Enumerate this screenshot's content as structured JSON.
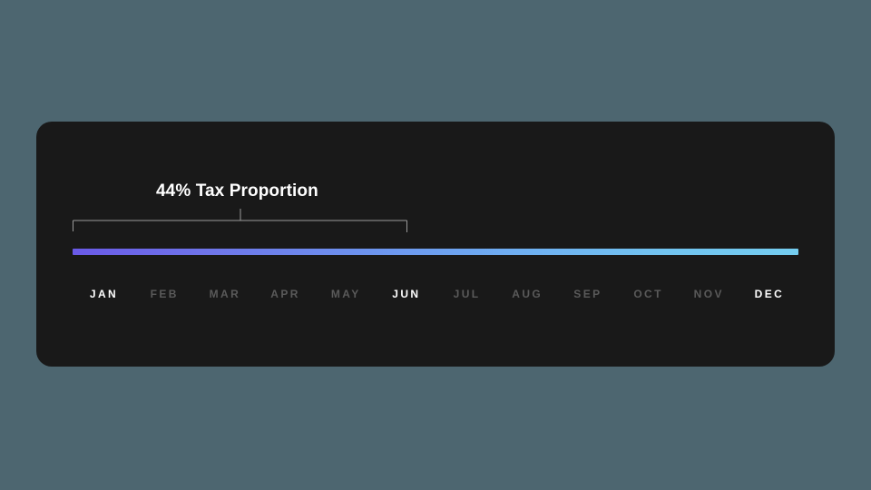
{
  "page": {
    "background_color": "#4d6670"
  },
  "card": {
    "background_color": "#191919",
    "corner_radius": "17px"
  },
  "callout": {
    "label": "44% Tax Proportion",
    "value_percent": 44,
    "metric_name": "Tax Proportion",
    "line_color": "#9a9a9a",
    "text_color": "#ffffff",
    "range_start_month": "JAN",
    "range_end_month": "JUN"
  },
  "bar": {
    "gradient_start_color": "#6a5ae8",
    "gradient_end_color": "#74cdf0",
    "fill_percent": 100
  },
  "axis": {
    "active_color": "#ffffff",
    "inactive_color": "#5a5a5a",
    "months": [
      {
        "label": "JAN",
        "active": true
      },
      {
        "label": "FEB",
        "active": false
      },
      {
        "label": "MAR",
        "active": false
      },
      {
        "label": "APR",
        "active": false
      },
      {
        "label": "MAY",
        "active": false
      },
      {
        "label": "JUN",
        "active": true
      },
      {
        "label": "JUL",
        "active": false
      },
      {
        "label": "AUG",
        "active": false
      },
      {
        "label": "SEP",
        "active": false
      },
      {
        "label": "OCT",
        "active": false
      },
      {
        "label": "NOV",
        "active": false
      },
      {
        "label": "DEC",
        "active": true
      }
    ]
  },
  "chart_data": {
    "type": "bar",
    "title": "44% Tax Proportion",
    "xlabel": "",
    "ylabel": "",
    "categories": [
      "JAN",
      "FEB",
      "MAR",
      "APR",
      "MAY",
      "JUN",
      "JUL",
      "AUG",
      "SEP",
      "OCT",
      "NOV",
      "DEC"
    ],
    "highlighted_categories": [
      "JAN",
      "JUN",
      "DEC"
    ],
    "annotations": [
      {
        "text": "44% Tax Proportion",
        "value": 44,
        "units": "%",
        "span_from": "JAN",
        "span_to": "JUN",
        "style": "bracket"
      }
    ],
    "series": [
      {
        "name": "Tax Proportion",
        "type": "gradient-bar",
        "values": [
          100
        ],
        "gradient": [
          "#6a5ae8",
          "#74cdf0"
        ]
      }
    ],
    "grid": false,
    "legend": "none"
  }
}
